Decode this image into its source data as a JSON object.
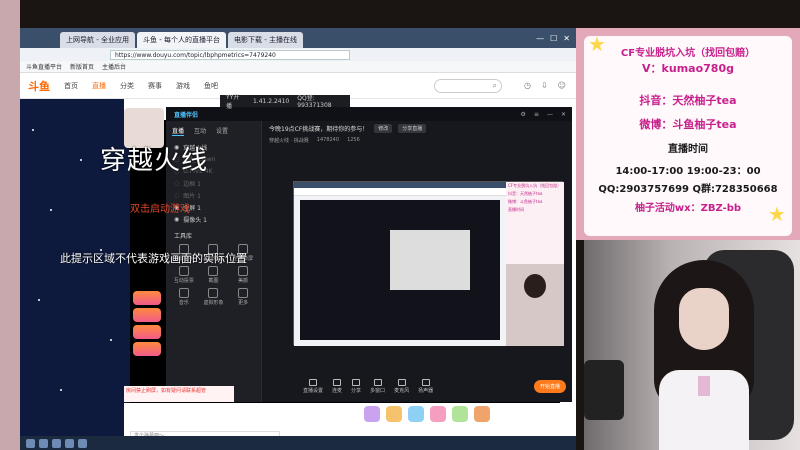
{
  "browser": {
    "tabs": [
      {
        "label": "上网导航 - 全业应用"
      },
      {
        "label": "斗鱼 - 每个人的直播平台"
      },
      {
        "label": "电影下载 - 主播在线"
      }
    ],
    "address": "https://www.douyu.com/topic/lbphpmetrics=7479240",
    "bookmarks": [
      "斗鱼直播平台",
      "新版首页",
      "主播后台"
    ]
  },
  "site": {
    "logo": "斗鱼",
    "nav": [
      "首页",
      "直播",
      "分类",
      "赛事",
      "游戏",
      "鱼吧"
    ],
    "active_nav": "直播"
  },
  "yy": {
    "title": "YY开播",
    "version": "1.41.2.2410",
    "qq": "QQ登: 993371308"
  },
  "obs": {
    "brand": "直播伴侣",
    "tabs": [
      "直播",
      "互动",
      "设置"
    ],
    "sources": [
      {
        "name": "穿越火线",
        "dim": false
      },
      {
        "name": "full_screen",
        "dim": true
      },
      {
        "name": "G.FIVE 4K",
        "dim": true
      },
      {
        "name": "边框 1",
        "dim": true
      },
      {
        "name": "图片 1",
        "dim": true
      },
      {
        "name": "全屏 1",
        "dim": false
      },
      {
        "name": "摄像头 1",
        "dim": false
      }
    ],
    "tools_header": "工具库",
    "tools": [
      "弹幕助手",
      "礼物特效",
      "全景录屏",
      "互动投票",
      "截图",
      "美颜",
      "音乐",
      "虚拟形象",
      "更多"
    ],
    "topic": "今晚19点CF挑战赛，期待你的参与！",
    "topic_btn": "修改",
    "topic_btn2": "分享直播",
    "info": [
      "穿越火线 · 挑战赛",
      "1478240",
      "1256"
    ],
    "game_name": "穿越火线",
    "hint_start": "双击启动游戏",
    "hint_area": "此提示区域不代表游戏画面的实际位置",
    "bottom": [
      "直播设置",
      "连麦",
      "分享",
      "多窗口",
      "麦克风",
      "扬声器"
    ],
    "start": "开始直播"
  },
  "page": {
    "chat_placeholder": "发个弹幕吧～",
    "red_note": "房间禁止刷屏，如有疑问请联系超管"
  },
  "overlay": {
    "line1": "CF专业脱坑入坑（找回包赔）",
    "line2": "V：kumao780g",
    "line3": "抖音：天然柚子tea",
    "line4": "微博：斗鱼柚子tea",
    "line5": "直播时间",
    "line6": "14:00-17:00  19:00-23：00",
    "line7": "QQ:2903757699 Q群:728350668",
    "line8": "柚子活动wx：ZBZ-bb"
  },
  "colors": {
    "accent": "#c71f8c",
    "orange": "#ff7a1a",
    "brand": "#4ec3ff"
  }
}
